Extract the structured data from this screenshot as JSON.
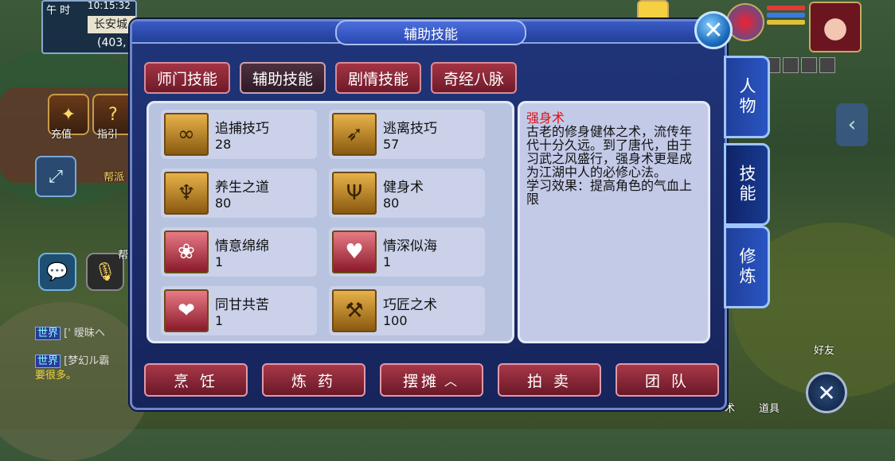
{
  "hud": {
    "time_label": "午 时",
    "clock": "10:15:32",
    "city": "长安城",
    "coords": "(403,"
  },
  "left_menu": {
    "recharge": "充值",
    "guide": "指引",
    "gang": "帮派",
    "help": "帮"
  },
  "chat": [
    {
      "channel": "世界",
      "text": "[' 暧昧ヘ"
    },
    {
      "channel": "世界",
      "text": "[梦幻ル霸"
    },
    {
      "channel": "",
      "text": "要很多。"
    }
  ],
  "panel": {
    "title": "辅助技能",
    "close_icon": "close-icon",
    "tabs": [
      {
        "label": "师门技能",
        "active": false
      },
      {
        "label": "辅助技能",
        "active": true
      },
      {
        "label": "剧情技能",
        "active": false
      },
      {
        "label": "奇经八脉",
        "active": false
      }
    ],
    "skills": [
      {
        "name": "追捕技巧",
        "level": "28",
        "icon": "capture-icon",
        "style": "gold"
      },
      {
        "name": "逃离技巧",
        "level": "57",
        "icon": "escape-icon",
        "style": "gold"
      },
      {
        "name": "养生之道",
        "level": "80",
        "icon": "health-icon",
        "style": "gold"
      },
      {
        "name": "健身术",
        "level": "80",
        "icon": "fitness-icon",
        "style": "gold"
      },
      {
        "name": "情意绵绵",
        "level": "1",
        "icon": "affection-icon",
        "style": "red"
      },
      {
        "name": "情深似海",
        "level": "1",
        "icon": "deep-love-icon",
        "style": "red"
      },
      {
        "name": "同甘共苦",
        "level": "1",
        "icon": "share-hardship-icon",
        "style": "red"
      },
      {
        "name": "巧匠之术",
        "level": "100",
        "icon": "craftsman-icon",
        "style": "gold"
      }
    ],
    "description": {
      "title": "强身术",
      "body": "古老的修身健体之术，流传年代十分久远。到了唐代，由于习武之风盛行，强身术更是成为江湖中人的必修心法。",
      "effect": "学习效果：提高角色的气血上限"
    },
    "bottom_buttons": [
      "烹 饪",
      "炼 药",
      "摆摊",
      "拍 卖",
      "团 队"
    ],
    "side_tabs": [
      {
        "label": "人物",
        "active": false
      },
      {
        "label": "技能",
        "active": true
      },
      {
        "label": "修炼",
        "active": false
      }
    ]
  },
  "right_hud": {
    "friends": "好友",
    "items": "道具",
    "tech": "术"
  }
}
